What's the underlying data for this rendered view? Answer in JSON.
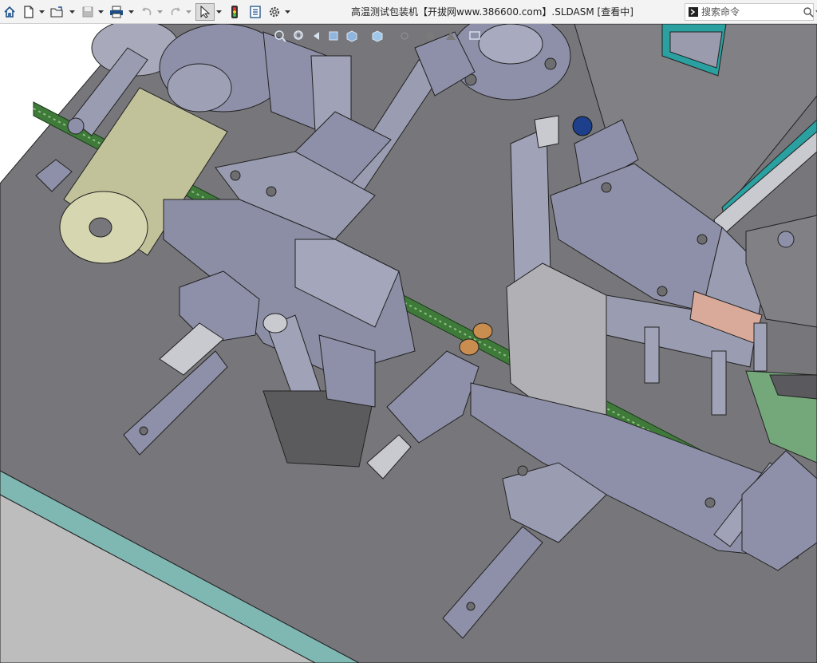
{
  "window": {
    "title": "高温测试包装机【开拔网www.386600.com】.SLDASM [查看中]"
  },
  "toolbar": {
    "buttons": [
      {
        "name": "home-icon"
      },
      {
        "name": "new-document-icon"
      },
      {
        "name": "open-file-icon"
      },
      {
        "name": "save-icon"
      },
      {
        "name": "print-icon"
      },
      {
        "name": "undo-icon"
      },
      {
        "name": "redo-icon"
      },
      {
        "name": "select-cursor-icon"
      },
      {
        "name": "traffic-light-icon"
      },
      {
        "name": "file-properties-icon"
      },
      {
        "name": "gear-icon"
      }
    ]
  },
  "search": {
    "placeholder": "搜索命令",
    "icon": "search-icon"
  },
  "heads_up_toolbar": {
    "items": [
      "zoom-to-fit-icon",
      "zoom-area-icon",
      "previous-view-icon",
      "section-view-icon",
      "view-orientation-icon",
      "display-style-icon",
      "hide-show-icon",
      "edit-appearance-icon",
      "apply-scene-icon",
      "view-settings-icon"
    ]
  },
  "colors": {
    "background": "#6e6e70",
    "plate": "#77777b",
    "plate_edge": "#79b3b0",
    "part_grey": "#8d90a8",
    "part_light": "#a6a9bd",
    "roller": "#c2c29a",
    "chain": "#3f7a3a",
    "teal": "#2aa0a0",
    "green_part": "#74a77a",
    "orange": "#c98d4f",
    "pink": "#d9a99a",
    "blue_knob": "#1d3f8c"
  }
}
